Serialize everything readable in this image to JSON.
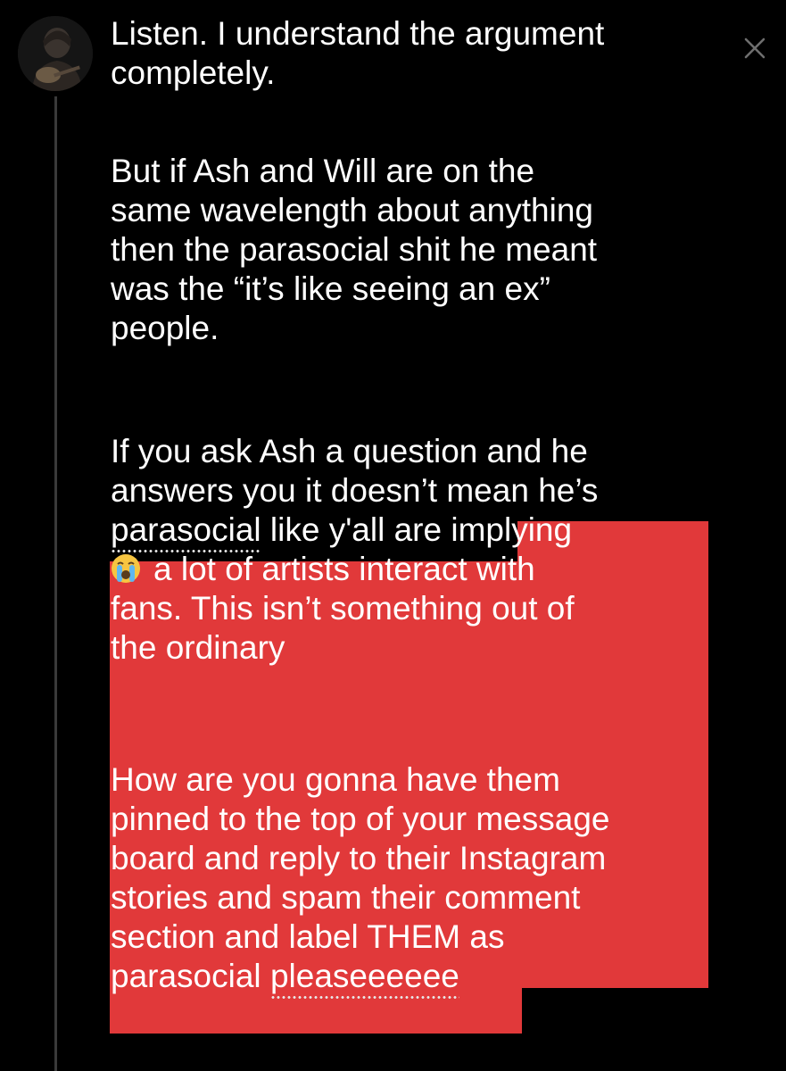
{
  "tweet": {
    "paragraph1": [
      "Listen. I understand the argument",
      "completely."
    ],
    "paragraph2": [
      "But if Ash and Will are on the",
      "same wavelength about anything",
      "then the parasocial shit he meant",
      "was the “it’s like seeing an ex”",
      "people."
    ],
    "paragraph3": {
      "line1": "If you ask Ash a question and he",
      "line2": "answers you it doesn’t mean he’s",
      "line3_word": "parasocial",
      "line3_rest": " like y'all are implying",
      "line4": "a lot of artists interact with",
      "line5": "fans. This isn’t something out of",
      "line6": "the ordinary"
    },
    "paragraph4": {
      "line1": "How are you gonna have them",
      "line2": "pinned to the top of your message",
      "line3": "board and reply to their Instagram",
      "line4": "stories and spam their comment",
      "line5": "section and label THEM as",
      "line6_word1": "parasocial",
      "line6_space": " ",
      "line6_word2": "pleaseeeeee"
    },
    "emoji": "loudly-crying-face-emoji"
  },
  "icons": {
    "close": "close-icon",
    "avatar": "profile-avatar"
  },
  "colors": {
    "background": "#000000",
    "text": "#ffffff",
    "highlight": "#e1393a",
    "thread_line": "#3a3a3a",
    "close_icon": "#6e6e6e"
  }
}
